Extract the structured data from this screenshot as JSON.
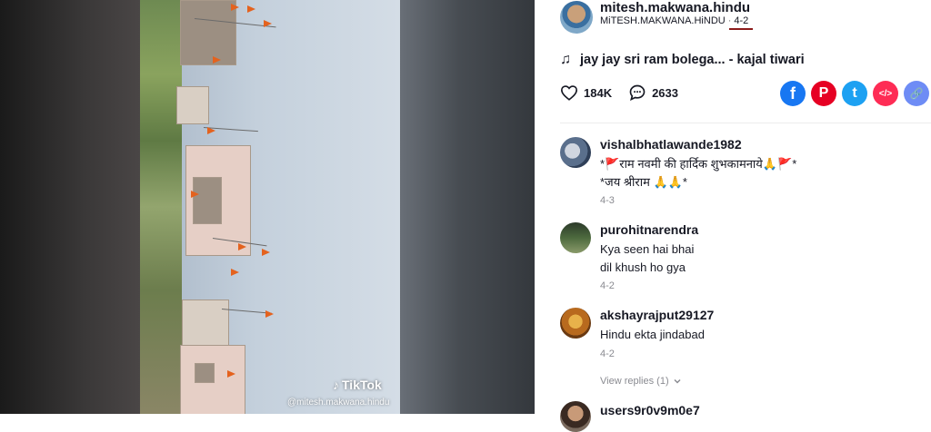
{
  "video": {
    "watermark_label": "TikTok",
    "watermark_handle": "@mitesh.makwana.hindu"
  },
  "author": {
    "username": "mitesh.makwana.hindu",
    "nickname": "MiTESH.MAKWANA.HiNDU",
    "date": "4-2",
    "separator": "·"
  },
  "music": {
    "icon": "music-note-icon",
    "title": "jay jay sri ram bolega... - kajal tiwari"
  },
  "stats": {
    "likes": "184K",
    "comments": "2633"
  },
  "share": {
    "buttons": [
      {
        "name": "facebook",
        "glyph": "f",
        "color": "#1877f2"
      },
      {
        "name": "pinterest",
        "glyph": "P",
        "color": "#e60023"
      },
      {
        "name": "twitter",
        "glyph": "t",
        "color": "#1da1f2"
      },
      {
        "name": "embed",
        "glyph": "</>",
        "color": "#fe2c55"
      },
      {
        "name": "copy-link",
        "glyph": "🔗",
        "color": "#6e8cf5"
      }
    ]
  },
  "comments": [
    {
      "user": "vishalbhatlawande1982",
      "lines": [
        "*🚩राम नवमी की हार्दिक शुभकामनाये🙏🚩*",
        "*जय श्रीराम 🙏🙏*"
      ],
      "date": "4-3"
    },
    {
      "user": "purohitnarendra",
      "lines": [
        "Kya seen hai bhai",
        "dil khush ho gya"
      ],
      "date": "4-2"
    },
    {
      "user": "akshayrajput29127",
      "lines": [
        "Hindu ekta jindabad"
      ],
      "date": "4-2"
    },
    {
      "user": "users9r0v9m0e7",
      "lines": [],
      "date": ""
    }
  ],
  "view_replies": {
    "label": "View replies (1)",
    "icon": "chevron-down-icon"
  }
}
